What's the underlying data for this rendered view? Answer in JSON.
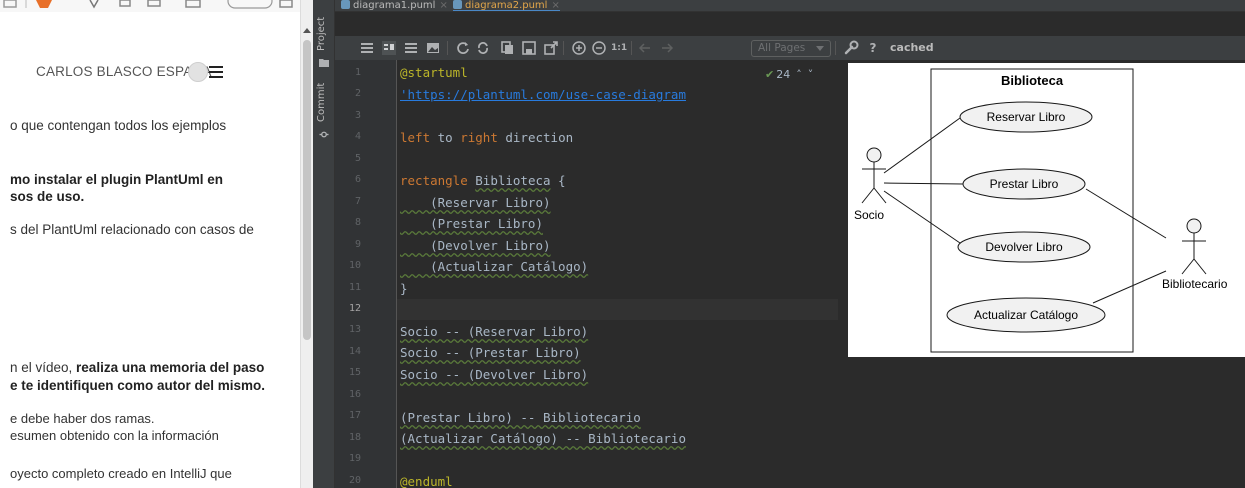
{
  "web_page": {
    "author": "CARLOS BLASCO ESPADA",
    "lines": [
      "o que contengan todos los  ejemplos",
      "mo instalar el plugin PlantUml en",
      "sos de uso.",
      "s del PlantUml relacionado con casos de",
      "n el vídeo, ",
      "realiza una memoria del paso",
      "e te identifiquen como autor del mismo.",
      "e debe haber dos ramas.",
      "esumen obtenido con la información",
      "oyecto completo creado en IntelliJ que"
    ]
  },
  "ide": {
    "side_tabs": [
      "Project",
      "Commit"
    ],
    "tabs": [
      {
        "label": "diagrama1.puml",
        "active": false
      },
      {
        "label": "diagrama2.puml",
        "active": true
      }
    ],
    "toolbar": {
      "zoom_label": "1:1",
      "pages_select": "All Pages",
      "help": "?",
      "cached": "cached"
    },
    "inspections": {
      "count": "24"
    },
    "line_numbers": [
      "1",
      "2",
      "3",
      "4",
      "5",
      "6",
      "7",
      "8",
      "9",
      "10",
      "11",
      "12",
      "13",
      "14",
      "15",
      "16",
      "17",
      "18",
      "19",
      "20"
    ],
    "current_line": "12",
    "code": {
      "l1": "@startuml",
      "l2": "'https://plantuml.com/use-case-diagram",
      "l4_kw1": "left",
      "l4_t1": " to ",
      "l4_kw2": "right",
      "l4_t2": " direction",
      "l6_kw": "rectangle",
      "l6_name": "Biblioteca",
      "l6_t": " {",
      "l7": "    (Reservar Libro)",
      "l8": "    (Prestar Libro)",
      "l9": "    (Devolver Libro)",
      "l10": "    (Actualizar Catálogo)",
      "l11": "}",
      "l13": "Socio -- (Reservar Libro)",
      "l14": "Socio -- (Prestar Libro)",
      "l15": "Socio -- (Devolver Libro)",
      "l17": "(Prestar Libro) -- Bibliotecario",
      "l18": "(Actualizar Catálogo) -- Bibliotecario",
      "l20": "@enduml"
    }
  },
  "diagram": {
    "boundary": "Biblioteca",
    "actors": [
      "Socio",
      "Bibliotecario"
    ],
    "use_cases": [
      "Reservar Libro",
      "Prestar Libro",
      "Devolver Libro",
      "Actualizar Catálogo"
    ]
  }
}
